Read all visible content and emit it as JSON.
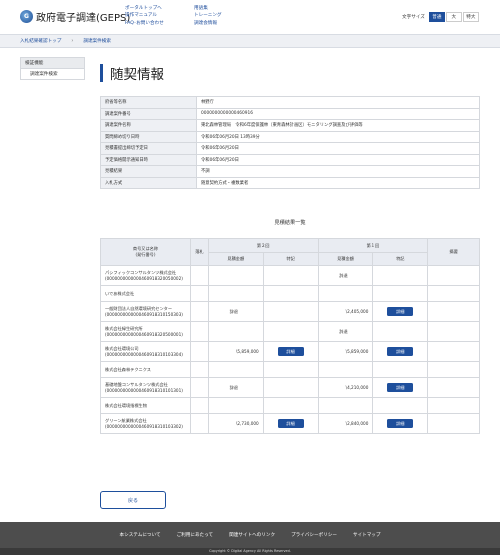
{
  "header": {
    "logo_text": "政府電子調達(GEPS)",
    "logo_mark": "G",
    "nav_col1": [
      "ポータルトップへ",
      "操作マニュアル",
      "FAQ･お問い合わせ"
    ],
    "nav_col2": [
      "用語集",
      "トレーニング",
      "調達会情報"
    ],
    "font_size_label": "文字サイズ",
    "font_sizes": [
      "普通",
      "大",
      "特大"
    ]
  },
  "breadcrumb": [
    "入札結果確認トップ",
    "調達案件検索"
  ],
  "sidebar": {
    "head": "検証機能",
    "items": [
      "調達案件検索"
    ]
  },
  "page": {
    "title": "随契情報"
  },
  "info": [
    {
      "k": "府省等名称",
      "v": "林野庁"
    },
    {
      "k": "調達案件番号",
      "v": "0000000000000460916"
    },
    {
      "k": "調達案件名称",
      "v": "東北森林管理局　令和6年度保護林（東青森林計画区）モニタリング調査及び評価等"
    },
    {
      "k": "質問締め切り日時",
      "v": "令和06年06月20日 13時39分"
    },
    {
      "k": "見積書提出締切予定日",
      "v": "令和06年06月20日"
    },
    {
      "k": "予定価格開示通知日時",
      "v": "令和06年06月20日"
    },
    {
      "k": "見積結果",
      "v": "不調"
    },
    {
      "k": "入札方式",
      "v": "随意契約方式・複数業者"
    }
  ],
  "results": {
    "title": "見積結果一覧",
    "col_name": "商号又は名称\n(発行番号)",
    "col_rank": "落札",
    "round2": "第２回",
    "round1": "第１回",
    "col_amount": "見積金額",
    "col_note": "特記",
    "col_remarks": "摘要",
    "detail_label": "詳細",
    "rows": [
      {
        "name": "パシフィックコンサルタンツ株式会社",
        "code": "(0000000000000460918320050002)",
        "r2_amt": "",
        "r2_btn": false,
        "r1_amt": "辞退",
        "r1_btn": false
      },
      {
        "name": "いであ株式会社",
        "code": "",
        "r2_amt": "",
        "r2_btn": false,
        "r1_amt": "",
        "r1_btn": false
      },
      {
        "name": "一般財団法人自然環境研究センター",
        "code": "(0000000000000460918310150303)",
        "r2_amt": "辞退",
        "r2_btn": false,
        "r1_amt": "\\2,405,000",
        "r1_btn": true
      },
      {
        "name": "株式会社緑生研究所",
        "code": "(0000000000000460918320500001)",
        "r2_amt": "",
        "r2_btn": false,
        "r1_amt": "辞退",
        "r1_btn": false
      },
      {
        "name": "株式会社環境公司",
        "code": "(0000000000000460918310103304)",
        "r2_amt": "\\5,859,000",
        "r2_btn": true,
        "r1_amt": "\\5,859,000",
        "r1_btn": true
      },
      {
        "name": "株式会社森林テクニクス",
        "code": "",
        "r2_amt": "",
        "r2_btn": false,
        "r1_amt": "",
        "r1_btn": false
      },
      {
        "name": "基礎地盤コンサルタンツ株式会社",
        "code": "(0000000000000460918310101301)",
        "r2_amt": "辞退",
        "r2_btn": false,
        "r1_amt": "\\4,210,000",
        "r1_btn": true
      },
      {
        "name": "株式会社環境指標生物",
        "code": "",
        "r2_amt": "",
        "r2_btn": false,
        "r1_amt": "",
        "r1_btn": false
      },
      {
        "name": "グリーン航業株式会社",
        "code": "(0000000000000460918310103302)",
        "r2_amt": "\\2,730,000",
        "r2_btn": true,
        "r1_amt": "\\2,840,000",
        "r1_btn": true
      }
    ]
  },
  "back_label": "戻る",
  "footer": {
    "links": [
      "本システムについて",
      "ご利用にあたって",
      "関連サイトへのリンク",
      "プライバシーポリシー",
      "サイトマップ"
    ],
    "copyright": "Copyright © Digital Agency All Rights Reserved."
  }
}
